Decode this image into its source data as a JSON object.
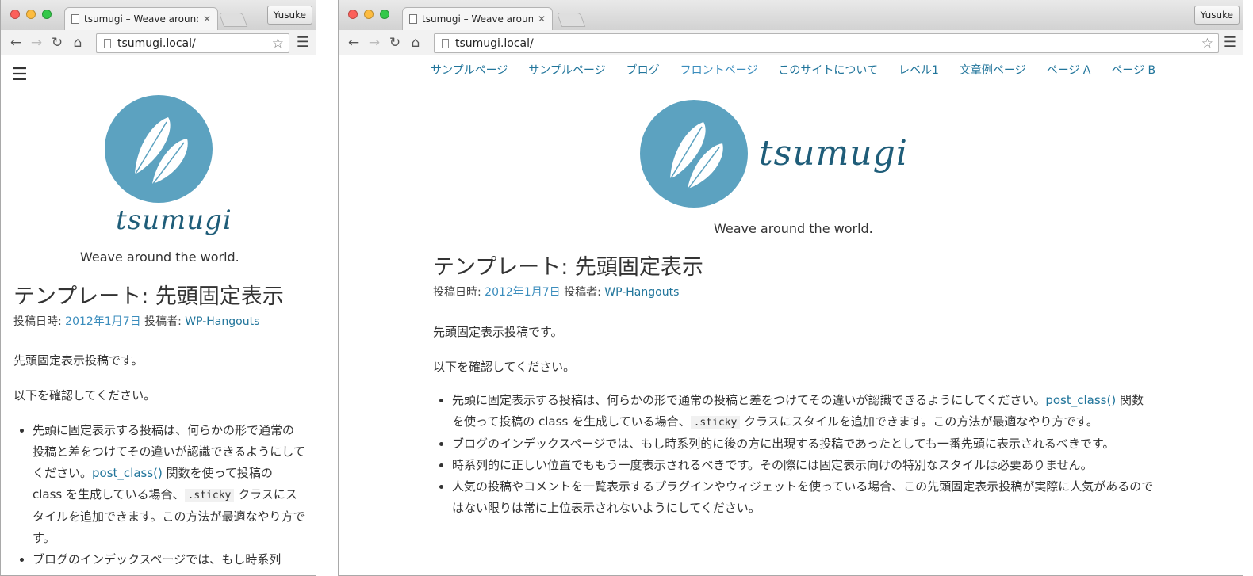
{
  "browser": {
    "tab_title": "tsumugi – Weave around the world.",
    "url": "tsumugi.local/",
    "profile_name": "Yusuke"
  },
  "site": {
    "brand": "tsumugi",
    "tagline": "Weave around the world.",
    "nav": [
      "サンプルページ",
      "サンプルページ",
      "ブログ",
      "フロントページ",
      "このサイトについて",
      "レベル1",
      "文章例ページ",
      "ページ A",
      "ページ B"
    ]
  },
  "post": {
    "title": "テンプレート: 先頭固定表示",
    "meta_posted_label": "投稿日時:",
    "meta_date": "2012年1月7日",
    "meta_author_label": "投稿者:",
    "meta_author": "WP-Hangouts",
    "para1": "先頭固定表示投稿です。",
    "para2": "以下を確認してください。",
    "item1_pre": "先頭に固定表示する投稿は、何らかの形で通常の投稿と差をつけてその違いが認識できるようにしてください。",
    "item1_link": "post_class()",
    "item1_mid": " 関数を使って投稿の class を生成している場合、",
    "item1_code": ".sticky",
    "item1_post": " クラスにスタイルを追加できます。この方法が最適なやり方です。",
    "item2": "ブログのインデックスページでは、もし時系列的に後の方に出現する投稿であったとしても一番先頭に表示されるべきです。",
    "item3": "時系列的に正しい位置でももう一度表示されるべきです。その際には固定表示向けの特別なスタイルは必要ありません。",
    "item4": "人気の投稿やコメントを一覧表示するプラグインやウィジェットを使っている場合、この先頭固定表示投稿が実際に人気があるのではない限りは常に上位表示されないようにしてください。",
    "mobile_item2_visible": "ブログのインデックスページでは、もし時系列"
  },
  "colors": {
    "link": "#21759b",
    "logo": "#5ca2c0",
    "brand": "#1f5d79"
  }
}
